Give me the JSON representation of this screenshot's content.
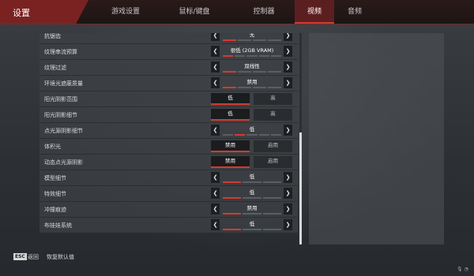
{
  "header": {
    "title": "设置",
    "tabs": [
      {
        "label": "游戏设置",
        "active": false
      },
      {
        "label": "鼠标/键盘",
        "active": false
      },
      {
        "label": "控制器",
        "active": false
      },
      {
        "label": "视频",
        "active": true
      },
      {
        "label": "音频",
        "active": false
      }
    ]
  },
  "settings": [
    {
      "label": "抗锯齿",
      "type": "selector",
      "value": "无",
      "steps": 4,
      "level": 1
    },
    {
      "label": "纹理串流预算",
      "type": "selector",
      "value": "很低 (2GB VRAM)",
      "steps": 5,
      "level": 1
    },
    {
      "label": "纹理过滤",
      "type": "selector",
      "value": "双线性",
      "steps": 4,
      "level": 1
    },
    {
      "label": "环境光遮蔽质量",
      "type": "selector",
      "value": "禁用",
      "steps": 4,
      "level": 1
    },
    {
      "label": "阳光阴影范围",
      "type": "toggle",
      "options": [
        "低",
        "高"
      ],
      "selected": 0
    },
    {
      "label": "阳光阴影细节",
      "type": "toggle",
      "options": [
        "低",
        "高"
      ],
      "selected": 0
    },
    {
      "label": "点光源阴影细节",
      "type": "selector",
      "value": "低",
      "steps": 5,
      "level": 2
    },
    {
      "label": "体积光",
      "type": "toggle",
      "options": [
        "禁用",
        "启用"
      ],
      "selected": 0
    },
    {
      "label": "动态点光源阴影",
      "type": "toggle",
      "options": [
        "禁用",
        "启用"
      ],
      "selected": 0
    },
    {
      "label": "模型细节",
      "type": "selector",
      "value": "低",
      "steps": 3,
      "level": 1
    },
    {
      "label": "特效细节",
      "type": "selector",
      "value": "低",
      "steps": 3,
      "level": 1
    },
    {
      "label": "冲撞痕迹",
      "type": "selector",
      "value": "禁用",
      "steps": 3,
      "level": 1
    },
    {
      "label": "布娃娃系统",
      "type": "selector",
      "value": "低",
      "steps": 3,
      "level": 1
    }
  ],
  "scroll": {
    "position_fraction": 0.47
  },
  "footer": {
    "esc_key": "ESC",
    "back_label": "返回",
    "reset_label": "恢复默认值"
  },
  "colors": {
    "accent": "#d43a2f",
    "header_title_bg": "#7a2222",
    "active_tab_bg": "#5c1f1f"
  },
  "icons": {
    "left_arrow": "chevron-left-icon",
    "right_arrow": "chevron-right-icon",
    "microphone": "microphone-icon",
    "network": "network-icon"
  }
}
